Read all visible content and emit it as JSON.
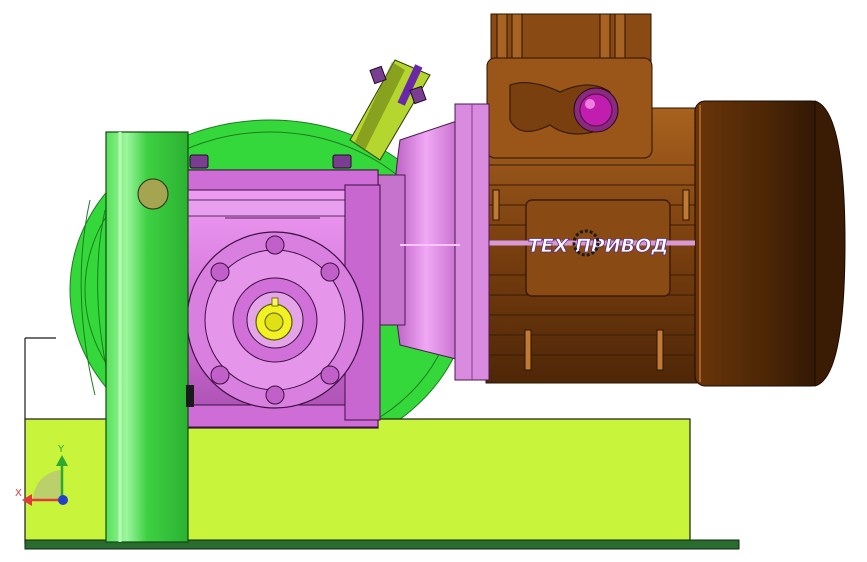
{
  "viewport": {
    "background": "#ffffff"
  },
  "model": {
    "logo_text": "ТЕХ ПРИВОД",
    "colors": {
      "base_plate": "#c8f53c",
      "base_plate_edge": "#1a1a1a",
      "green_housing": "#35d83a",
      "green_dark": "#1e9b25",
      "gearbox_pink": "#e07de8",
      "gearbox_dark": "#8a3b8f",
      "motor_brown": "#8a4a14",
      "motor_dark": "#4a2508",
      "bracket_lime": "#b5d62f",
      "bolt_purple": "#7a3e90",
      "shaft_yellow": "#f2f222",
      "cable_gland": "#c11eb0"
    }
  },
  "triad": {
    "x_label": "X",
    "y_label": "Y",
    "x_color": "#e23a3a",
    "y_color": "#2ea82e",
    "origin_color": "#2241c8"
  }
}
